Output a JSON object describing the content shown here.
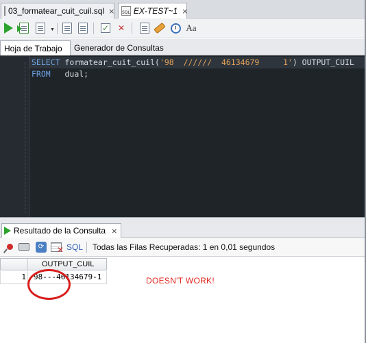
{
  "doc_tabs": [
    {
      "label": "03_formatear_cuit_cuil.sql",
      "close": "×",
      "icon": "sql-file-icon",
      "active": false
    },
    {
      "label": "EX-TEST~1",
      "close": "×",
      "icon": "sql-worksheet-icon",
      "active": true
    }
  ],
  "toolbar": {
    "icons": [
      "run-statement-icon",
      "run-script-icon",
      "commit-icon",
      "rollback-icon",
      "autotrace-icon",
      "clear-icon",
      "history-icon",
      "format-icon"
    ],
    "format_text": "Aa"
  },
  "worksheet_tabs": [
    {
      "label": "Hoja de Trabajo",
      "active": true
    },
    {
      "label": "Generador de Consultas",
      "active": false
    }
  ],
  "editor": {
    "line1": {
      "kw": "SELECT",
      "fn": " formatear_cuit_cuil(",
      "str": "'98  //////  46134679     1'",
      "rest": ") OUTPUT_CUIL"
    },
    "line2": {
      "kw": "FROM",
      "rest": "   dual;"
    }
  },
  "results": {
    "tab_label": "Resultado de la Consulta",
    "tab_close": "×",
    "sql_link": "SQL",
    "status": "Todas las Filas Recuperadas: 1 en 0,01 segundos",
    "grid": {
      "column": "OUTPUT_CUIL",
      "rows": [
        {
          "num": "1",
          "value": "98---46134679-1"
        }
      ]
    }
  },
  "annotation": "DOESN'T WORK!",
  "colors": {
    "editor_bg": "#1f2429",
    "keyword": "#6ea3e6",
    "string": "#e5a25a",
    "annotation": "#e0271f"
  }
}
